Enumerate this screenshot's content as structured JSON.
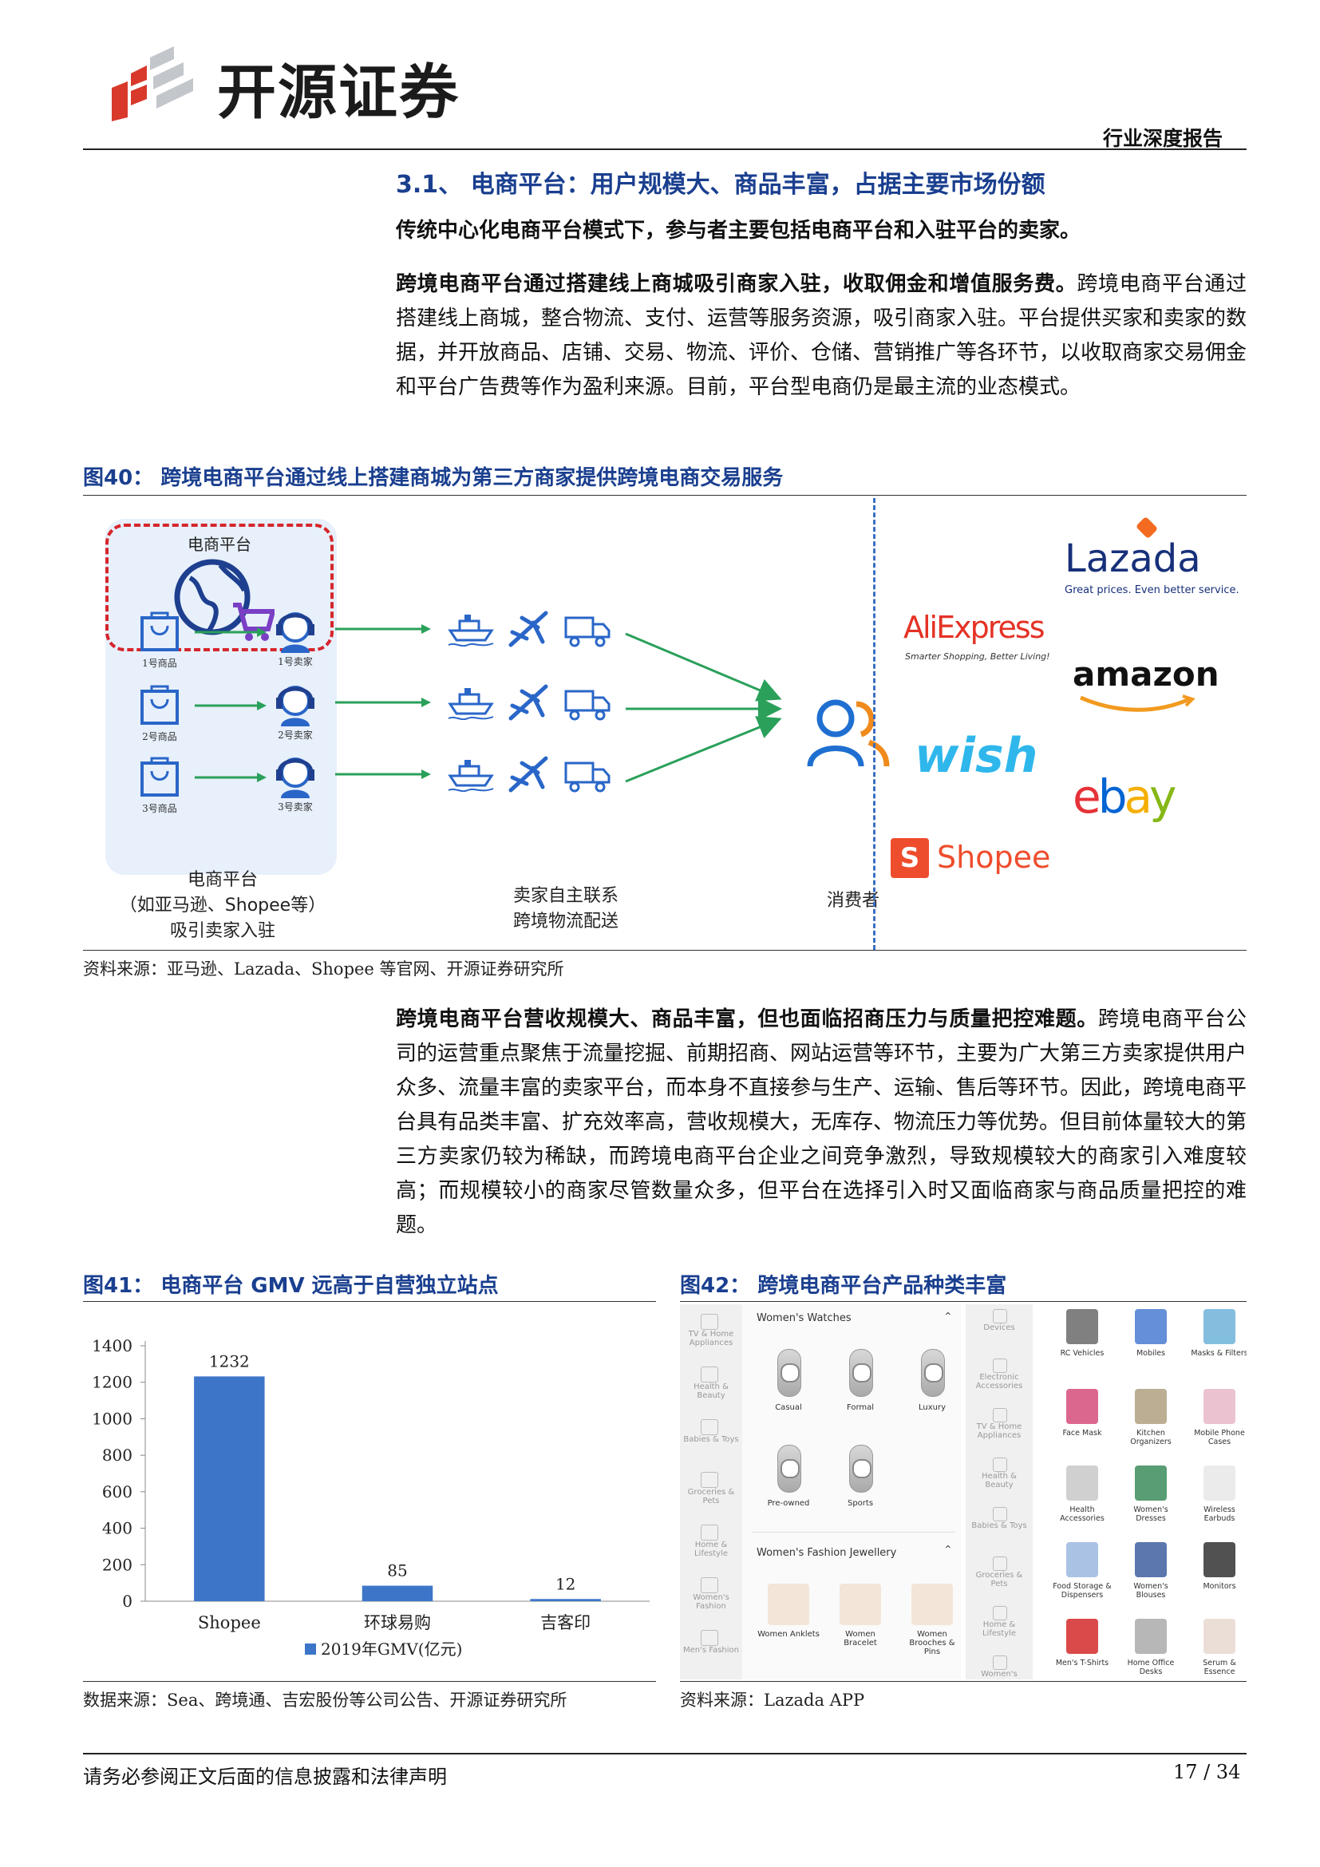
{
  "header": {
    "company": "开源证券",
    "report_type": "行业深度报告"
  },
  "section": {
    "title": "3.1、 电商平台：用户规模大、商品丰富，占据主要市场份额"
  },
  "para1": {
    "text": "传统中心化电商平台模式下，参与者主要包括电商平台和入驻平台的卖家。"
  },
  "para2": {
    "bold": "跨境电商平台通过搭建线上商城吸引商家入驻，收取佣金和增值服务费。",
    "text": "跨境电商平台通过搭建线上商城，整合物流、支付、运营等服务资源，吸引商家入驻。平台提供买家和卖家的数据，并开放商品、店铺、交易、物流、评价、仓储、营销推广等各环节，以收取商家交易佣金和平台广告费等作为盈利来源。目前，平台型电商仍是最主流的业态模式。"
  },
  "fig40": {
    "title": "图40：  跨境电商平台通过线上搭建商城为第三方商家提供跨境电商交易服务",
    "platform_label": "电商平台",
    "goods": [
      "1号商品",
      "2号商品",
      "3号商品"
    ],
    "sellers": [
      "1号卖家",
      "2号卖家",
      "3号卖家"
    ],
    "cap_platform_1": "电商平台",
    "cap_platform_2": "（如亚马逊、Shopee等）",
    "cap_platform_3": "吸引卖家入驻",
    "cap_logistics_1": "卖家自主联系",
    "cap_logistics_2": "跨境物流配送",
    "cap_consumer": "消费者",
    "brands": {
      "lazada": "Lazada",
      "lazada_tag": "Great prices. Even better service.",
      "aliexpress": "AliExpress",
      "aliexpress_tag": "Smarter Shopping, Better Living!",
      "amazon": "amazon",
      "wish": "wish",
      "ebay_e": "e",
      "ebay_b": "b",
      "ebay_a": "a",
      "ebay_y": "y",
      "shopee": "Shopee",
      "shopee_s": "S"
    },
    "source": "资料来源：亚马逊、Lazada、Shopee 等官网、开源证券研究所"
  },
  "para3": {
    "bold": "跨境电商平台营收规模大、商品丰富，但也面临招商压力与质量把控难题。",
    "text": "跨境电商平台公司的运营重点聚焦于流量挖掘、前期招商、网站运营等环节，主要为广大第三方卖家提供用户众多、流量丰富的卖家平台，而本身不直接参与生产、运输、售后等环节。因此，跨境电商平台具有品类丰富、扩充效率高，营收规模大，无库存、物流压力等优势。但目前体量较大的第三方卖家仍较为稀缺，而跨境电商平台企业之间竞争激烈，导致规模较大的商家引入难度较高；而规模较小的商家尽管数量众多，但平台在选择引入时又面临商家与商品质量把控的难题。"
  },
  "fig41": {
    "title": "图41：  电商平台 GMV 远高于自营独立站点",
    "source": "数据来源：Sea、跨境通、吉宏股份等公司公告、开源证券研究所"
  },
  "chart_data": {
    "type": "bar",
    "categories": [
      "Shopee",
      "环球易购",
      "吉客印"
    ],
    "series": [
      {
        "name": "2019年GMV(亿元)",
        "values": [
          1232,
          85,
          12
        ]
      }
    ],
    "ylim": [
      0,
      1400
    ],
    "yticks": [
      0,
      200,
      400,
      600,
      800,
      1000,
      1200,
      1400
    ],
    "legend": "bottom",
    "color": "#3d76c9"
  },
  "fig42": {
    "title": "图42：  跨境电商平台产品种类丰富",
    "source": "资料来源：Lazada APP",
    "left_sidebar": [
      "TV & Home Appliances",
      "Health & Beauty",
      "Babies & Toys",
      "Groceries & Pets",
      "Home & Lifestyle",
      "Women's Fashion",
      "Men's Fashion"
    ],
    "watch_header": "Women's Watches",
    "watches": [
      "Casual",
      "Formal",
      "Luxury",
      "Pre-owned",
      "Sports"
    ],
    "jewel_header": "Women's Fashion Jewellery",
    "jewels": [
      "Women Anklets",
      "Women Bracelet",
      "Women Brooches & Pins"
    ],
    "right_sidebar": [
      "Devices",
      "Electronic Accessories",
      "TV & Home Appliances",
      "Health & Beauty",
      "Babies & Toys",
      "Groceries & Pets",
      "Home & Lifestyle",
      "Women's Fashion"
    ],
    "products": [
      "RC Vehicles",
      "Mobiles",
      "Masks & Filters",
      "Face Mask",
      "Kitchen Organizers",
      "Mobile Phone Cases",
      "Health Accessories",
      "Women's Dresses",
      "Wireless Earbuds",
      "Food Storage & Dispensers",
      "Women's Blouses",
      "Monitors",
      "Men's T-Shirts",
      "Home Office Desks",
      "Serum & Essence"
    ]
  },
  "footer": {
    "disclaimer": "请务必参阅正文后面的信息披露和法律声明",
    "page": "17 / 34"
  }
}
